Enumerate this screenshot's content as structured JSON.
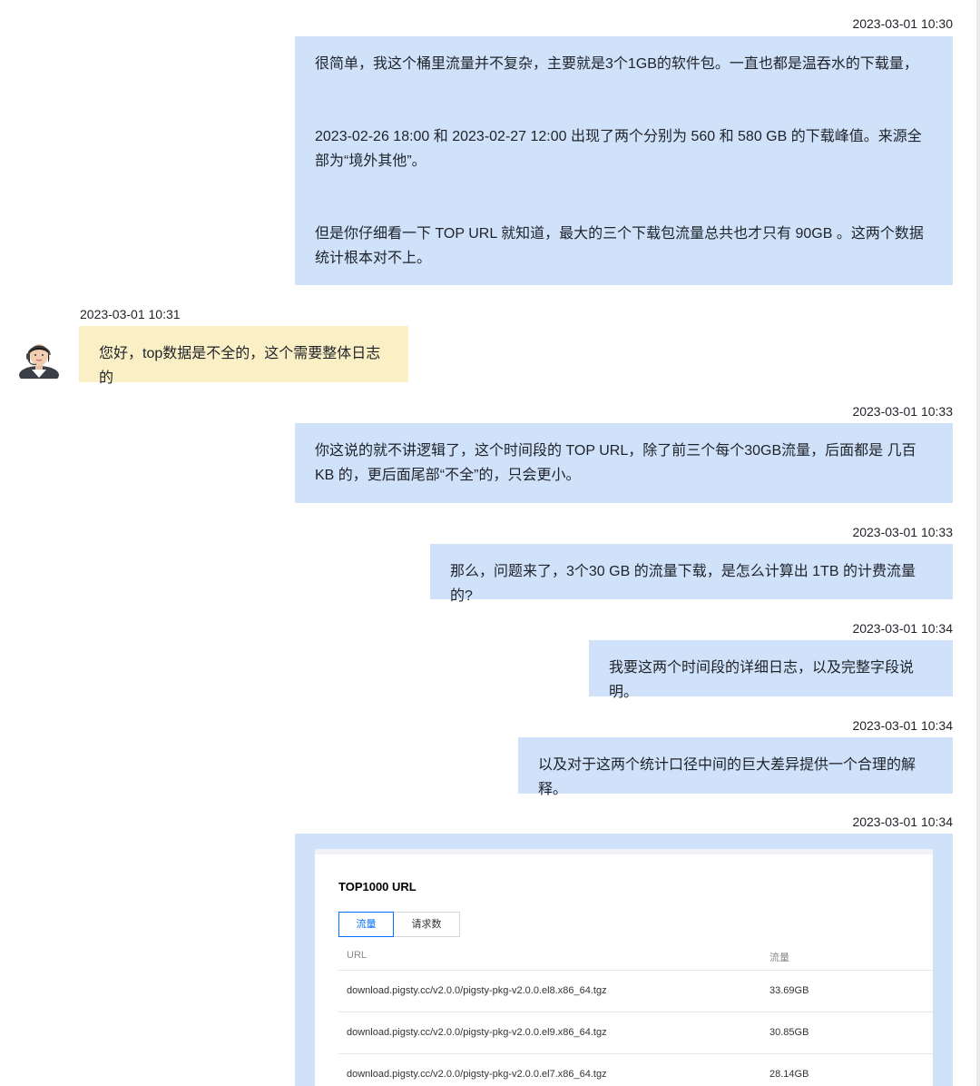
{
  "messages": [
    {
      "timestamp": "2023-03-01 10:30",
      "sender": "me",
      "paragraphs": [
        "很简单，我这个桶里流量并不复杂，主要就是3个1GB的软件包。一直也都是温吞水的下载量，",
        "2023-02-26 18:00 和 2023-02-27 12:00 出现了两个分别为 560 和 580 GB 的下载峰值。来源全部为“境外其他”。",
        "但是你仔细看一下 TOP URL 就知道，最大的三个下载包流量总共也才只有 90GB 。这两个数据统计根本对不上。"
      ]
    },
    {
      "timestamp": "2023-03-01 10:31",
      "sender": "agent",
      "paragraphs": [
        "您好，top数据是不全的，这个需要整体日志的"
      ]
    },
    {
      "timestamp": "2023-03-01 10:33",
      "sender": "me",
      "paragraphs": [
        "你这说的就不讲逻辑了，这个时间段的 TOP URL，除了前三个每个30GB流量，后面都是 几百KB 的，更后面尾部“不全”的，只会更小。"
      ]
    },
    {
      "timestamp": "2023-03-01 10:33",
      "sender": "me",
      "paragraphs": [
        "那么，问题来了，3个30 GB 的流量下载，是怎么计算出 1TB 的计费流量的?"
      ]
    },
    {
      "timestamp": "2023-03-01 10:34",
      "sender": "me",
      "paragraphs": [
        "我要这两个时间段的详细日志，以及完整字段说明。"
      ]
    },
    {
      "timestamp": "2023-03-01 10:34",
      "sender": "me",
      "paragraphs": [
        "以及对于这两个统计口径中间的巨大差异提供一个合理的解释。"
      ]
    },
    {
      "timestamp": "2023-03-01 10:34",
      "sender": "me",
      "paragraphs": []
    }
  ],
  "screenshot": {
    "title": "TOP1000 URL",
    "tabs": [
      {
        "label": "流量",
        "active": true
      },
      {
        "label": "请求数",
        "active": false
      }
    ],
    "columns": [
      "URL",
      "流量"
    ],
    "rows": [
      [
        "download.pigsty.cc/v2.0.0/pigsty-pkg-v2.0.0.el8.x86_64.tgz",
        "33.69GB"
      ],
      [
        "download.pigsty.cc/v2.0.0/pigsty-pkg-v2.0.0.el9.x86_64.tgz",
        "30.85GB"
      ],
      [
        "download.pigsty.cc/v2.0.0/pigsty-pkg-v2.0.0.el7.x86_64.tgz",
        "28.14GB"
      ]
    ]
  },
  "colors": {
    "my_bubble": "#d0e1fa",
    "agent_bubble": "#fbf0c5",
    "tab_active": "#006eff"
  },
  "icons": {
    "agent_avatar": "support-agent-avatar-icon"
  }
}
